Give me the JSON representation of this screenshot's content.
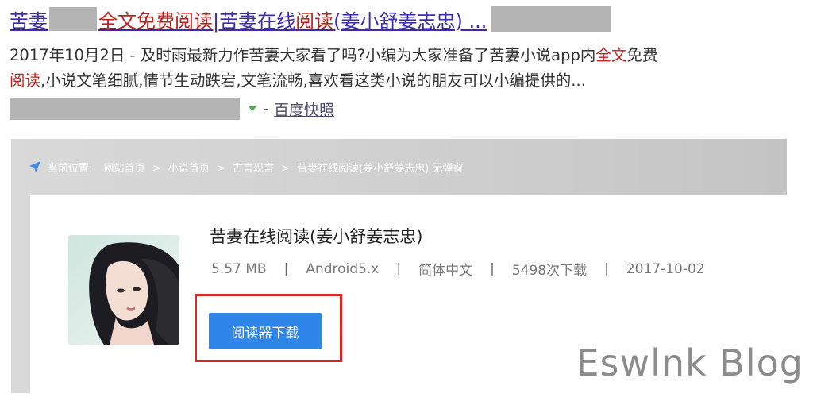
{
  "search_result": {
    "title": {
      "part1": "苦妻",
      "part2_highlight": "全文免费阅读",
      "part3": "|苦妻在线",
      "part4_highlight": "阅读",
      "part5": "(姜小舒姜志忠) ..."
    },
    "snippet": {
      "line1_prefix": "2017年10月2日 - 及时雨最新力作苦妻大家看了吗?小编为大家准备了苦妻小说app内",
      "line1_highlight": "全文",
      "line1_suffix": "免费",
      "line2_highlight": "阅读",
      "line2_suffix": ",小说文笔细腻,情节生动跌宕,文笔流畅,喜欢看这类小说的朋友可以小编提供的..."
    },
    "url_row": {
      "separator": "-",
      "snapshot_label": "百度快照"
    }
  },
  "site_page": {
    "breadcrumb": {
      "label": "当前位置:",
      "items": [
        "网站首页",
        "小说首页",
        "古言现言",
        "苦妻在线阅读(姜小舒姜志忠) 无弹窗"
      ],
      "separator": ">"
    },
    "app": {
      "name": "苦妻在线阅读(姜小舒姜志忠)",
      "size": "5.57 MB",
      "os": "Android5.x",
      "language": "简体中文",
      "downloads": "5498次下载",
      "date": "2017-10-02",
      "meta_separator": "|",
      "download_button": "阅读器下载"
    }
  },
  "watermark": "Eswlnk Blog",
  "colors": {
    "title_link": "#3a2bb5",
    "keyword_highlight": "#c0201c",
    "button_blue": "#2f86e8",
    "highlight_frame": "#d42a24"
  },
  "icons": {
    "breadcrumb": "location-arrow-icon",
    "url_dropdown": "caret-down-icon"
  }
}
